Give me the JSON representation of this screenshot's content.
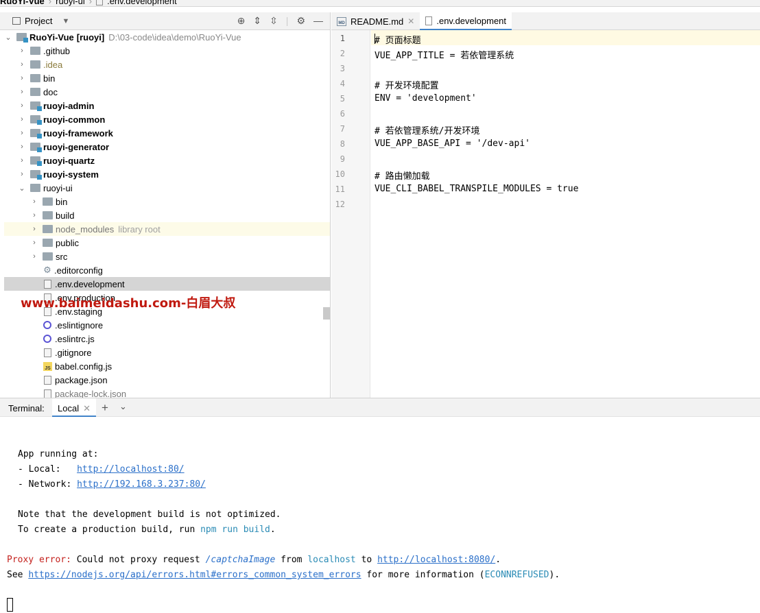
{
  "breadcrumb": [
    "RuoYi-Vue",
    "ruoyi-ui",
    ".env.development"
  ],
  "project_panel": {
    "title": "Project",
    "root": {
      "name": "RuoYi-Vue",
      "module": "[ruoyi]",
      "path": "D:\\03-code\\idea\\demo\\RuoYi-Vue"
    },
    "items": [
      {
        "name": ".github"
      },
      {
        "name": ".idea"
      },
      {
        "name": "bin"
      },
      {
        "name": "doc"
      },
      {
        "name": "ruoyi-admin"
      },
      {
        "name": "ruoyi-common"
      },
      {
        "name": "ruoyi-framework"
      },
      {
        "name": "ruoyi-generator"
      },
      {
        "name": "ruoyi-quartz"
      },
      {
        "name": "ruoyi-system"
      },
      {
        "name": "ruoyi-ui"
      },
      {
        "name": "bin"
      },
      {
        "name": "build"
      },
      {
        "name": "node_modules",
        "hint": "library root"
      },
      {
        "name": "public"
      },
      {
        "name": "src"
      },
      {
        "name": ".editorconfig"
      },
      {
        "name": ".env.development"
      },
      {
        "name": ".env.production"
      },
      {
        "name": ".env.staging"
      },
      {
        "name": ".eslintignore"
      },
      {
        "name": ".eslintrc.js"
      },
      {
        "name": ".gitignore"
      },
      {
        "name": "babel.config.js"
      },
      {
        "name": "package.json"
      },
      {
        "name": "package-lock.json"
      }
    ]
  },
  "watermark": "www.baimeidashu.com-白眉大叔",
  "editor": {
    "tabs": [
      {
        "label": "README.md",
        "icon": "markdown-file-icon",
        "icon_text": "MD"
      },
      {
        "label": ".env.development",
        "icon": "env-file-icon"
      }
    ],
    "line_numbers": [
      "1",
      "2",
      "3",
      "4",
      "5",
      "6",
      "7",
      "8",
      "9",
      "10",
      "11",
      "12"
    ],
    "lines": [
      "# 页面标题",
      "VUE_APP_TITLE = 若依管理系统",
      "",
      "# 开发环境配置",
      "ENV = 'development'",
      "",
      "# 若依管理系统/开发环境",
      "VUE_APP_BASE_API = '/dev-api'",
      "",
      "# 路由懒加载",
      "VUE_CLI_BABEL_TRANSPILE_MODULES = true",
      ""
    ]
  },
  "terminal": {
    "label": "Terminal:",
    "tab": "Local",
    "app_running": "App running at:",
    "local_label": "- Local:   ",
    "local_url": "http://localhost:80/",
    "network_label": "- Network: ",
    "network_url": "http://192.168.3.237:80/",
    "note": "Note that the development build is not optimized.",
    "create_prefix": "To create a production build, run ",
    "create_cmd": "npm run build",
    "create_suffix": ".",
    "proxy_error": "Proxy error:",
    "proxy_text1": " Could not proxy request ",
    "proxy_path": "/captchaImage",
    "proxy_text2": " from ",
    "proxy_host": "localhost",
    "proxy_text3": " to ",
    "proxy_target": "http://localhost:8080/",
    "proxy_text4": ".",
    "see_prefix": "See ",
    "see_url": "https://nodejs.org/api/errors.html#errors_common_system_errors",
    "see_text": " for more information (",
    "see_code": "ECONNREFUSED",
    "see_suffix": ")."
  },
  "colors": {
    "accent": "#4083c9",
    "link": "#2a6fc9",
    "error": "#c4211d",
    "watermark": "#c0190f",
    "module_badge": "#3592c4"
  }
}
